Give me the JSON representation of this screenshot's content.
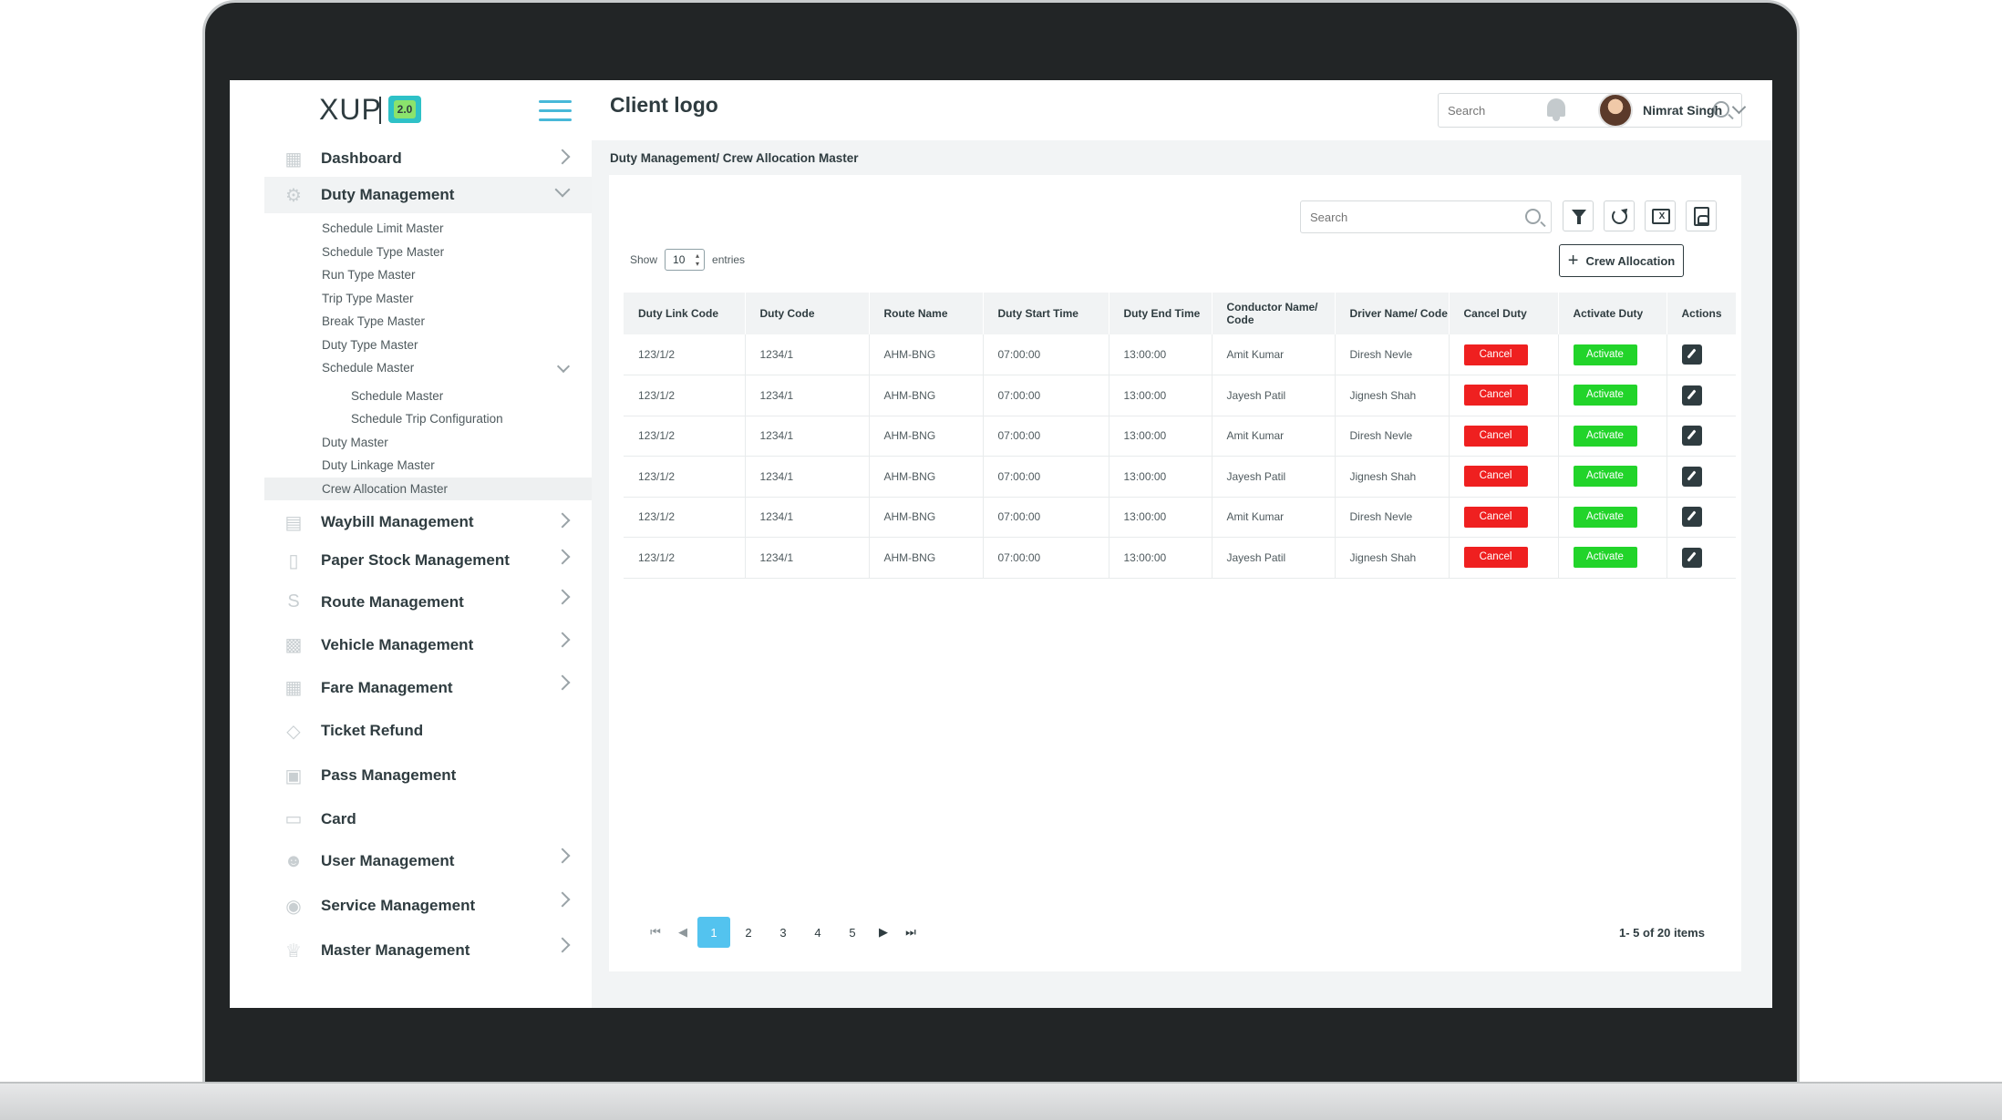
{
  "brand": {
    "logo_text": "XUP",
    "logo_badge": "2.0"
  },
  "header": {
    "client_logo": "Client logo",
    "search_placeholder": "Search",
    "user_name": "Nimrat Singh"
  },
  "sidebar": {
    "items": [
      {
        "label": "Dashboard",
        "icon": "dashboard-icon"
      },
      {
        "label": "Duty Management",
        "icon": "duty-icon"
      },
      {
        "label": "Waybill Management",
        "icon": "waybill-icon"
      },
      {
        "label": "Paper Stock Management",
        "icon": "paper-icon"
      },
      {
        "label": "Route Management",
        "icon": "route-icon"
      },
      {
        "label": "Vehicle Management",
        "icon": "vehicle-icon"
      },
      {
        "label": "Fare Management",
        "icon": "fare-icon"
      },
      {
        "label": "Ticket Refund",
        "icon": "ticket-icon"
      },
      {
        "label": "Pass Management",
        "icon": "pass-icon"
      },
      {
        "label": "Card",
        "icon": "card-icon"
      },
      {
        "label": "User Management",
        "icon": "users-icon"
      },
      {
        "label": "Service Management",
        "icon": "service-icon"
      },
      {
        "label": "Master Management",
        "icon": "crown-icon"
      }
    ],
    "duty_sub": [
      "Schedule Limit Master",
      "Schedule Type Master",
      "Run Type Master",
      "Trip Type Master",
      "Break Type Master",
      "Duty Type Master",
      "Schedule Master",
      "Schedule Master",
      "Schedule Trip Configuration",
      "Duty Master",
      "Duty Linkage Master",
      "Crew Allocation Master"
    ]
  },
  "breadcrumb": "Duty Management/ Crew Allocation Master",
  "toolbar": {
    "search_placeholder": "Search",
    "show_label": "Show",
    "entries_value": "10",
    "entries_label": "entries",
    "crew_button": "Crew Allocation"
  },
  "table": {
    "headers": [
      "Duty Link Code",
      "Duty Code",
      "Route Name",
      "Duty Start Time",
      "Duty End Time",
      "Conductor Name/ Code",
      "Driver Name/ Code",
      "Cancel Duty",
      "Activate Duty",
      "Actions"
    ],
    "cancel_label": "Cancel",
    "activate_label": "Activate",
    "rows": [
      [
        "123/1/2",
        "1234/1",
        "AHM-BNG",
        "07:00:00",
        "13:00:00",
        "Amit Kumar",
        "Diresh Nevle"
      ],
      [
        "123/1/2",
        "1234/1",
        "AHM-BNG",
        "07:00:00",
        "13:00:00",
        "Jayesh Patil",
        "Jignesh Shah"
      ],
      [
        "123/1/2",
        "1234/1",
        "AHM-BNG",
        "07:00:00",
        "13:00:00",
        "Amit Kumar",
        "Diresh Nevle"
      ],
      [
        "123/1/2",
        "1234/1",
        "AHM-BNG",
        "07:00:00",
        "13:00:00",
        "Jayesh Patil",
        "Jignesh Shah"
      ],
      [
        "123/1/2",
        "1234/1",
        "AHM-BNG",
        "07:00:00",
        "13:00:00",
        "Amit Kumar",
        "Diresh Nevle"
      ],
      [
        "123/1/2",
        "1234/1",
        "AHM-BNG",
        "07:00:00",
        "13:00:00",
        "Jayesh Patil",
        "Jignesh Shah"
      ]
    ]
  },
  "pagination": {
    "pages": [
      "1",
      "2",
      "3",
      "4",
      "5"
    ],
    "current": "1",
    "info": "1- 5 of 20 items"
  },
  "colors": {
    "accent": "#53c3ef",
    "cancel": "#ef2020",
    "activate": "#22d42a",
    "text": "#2f3c40"
  }
}
